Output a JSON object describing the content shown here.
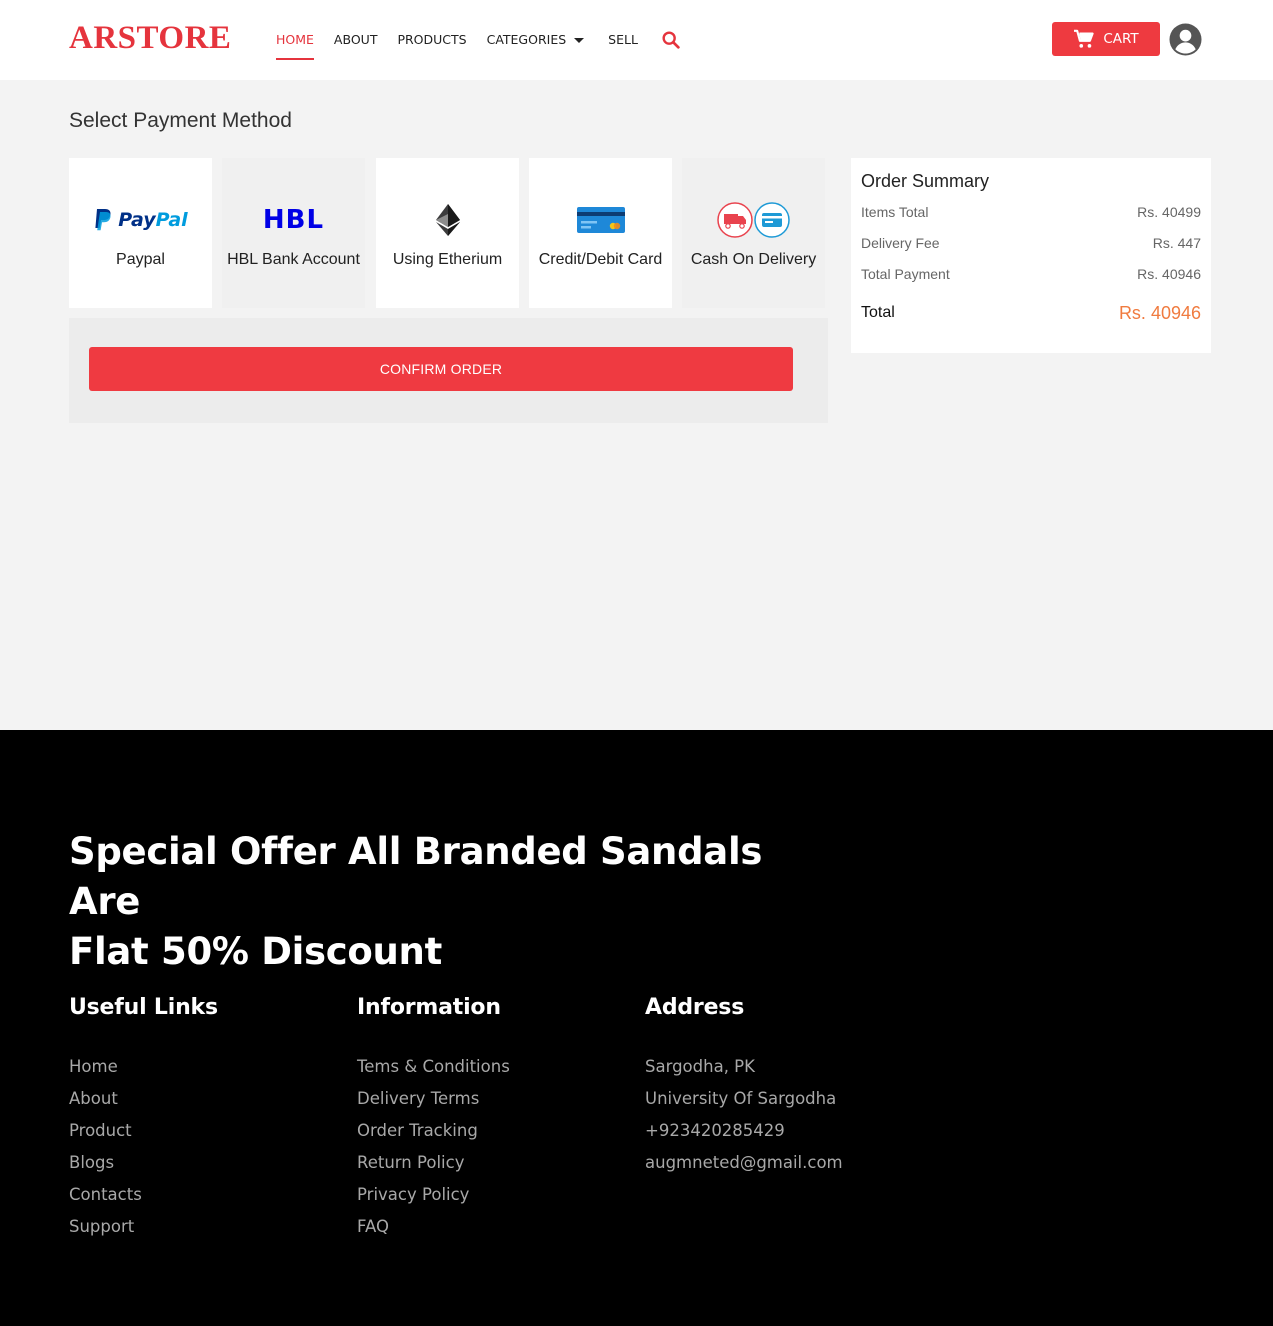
{
  "brand": {
    "logo": "ARSTORE",
    "accent": "#e5343d"
  },
  "nav": {
    "home": "HOME",
    "about": "ABOUT",
    "products": "PRODUCTS",
    "categories": "CATEGORIES",
    "sell": "SELL"
  },
  "header": {
    "cart_label": "CART"
  },
  "payment": {
    "title": "Select Payment Method",
    "methods": [
      {
        "label": "Paypal",
        "logo_text": "PayPal",
        "icon": "paypal-logo"
      },
      {
        "label": "HBL Bank Account",
        "logo_text": "HBL",
        "icon": "hbl-logo"
      },
      {
        "label": "Using Etherium",
        "icon": "ethereum-icon"
      },
      {
        "label": "Credit/Debit Card",
        "icon": "credit-card-icon"
      },
      {
        "label": "Cash On Delivery",
        "icon": "delivery-truck-icon"
      }
    ],
    "confirm_label": "CONFIRM ORDER"
  },
  "summary": {
    "title": "Order Summary",
    "rows": [
      {
        "label": "Items Total",
        "value": "Rs. 40499"
      },
      {
        "label": "Delivery Fee",
        "value": "Rs. 447"
      },
      {
        "label": "Total Payment",
        "value": "Rs. 40946"
      }
    ],
    "total_label": "Total",
    "total_value": "Rs. 40946",
    "total_color": "#f07b3f"
  },
  "footer": {
    "offer_line1": "Special Offer All Branded Sandals Are",
    "offer_line2": "Flat 50% Discount",
    "useful_links": {
      "title": "Useful Links",
      "items": [
        "Home",
        "About",
        "Product",
        "Blogs",
        "Contacts",
        "Support"
      ]
    },
    "information": {
      "title": "Information",
      "items": [
        "Tems & Conditions",
        "Delivery Terms",
        "Order Tracking",
        "Return Policy",
        "Privacy Policy",
        "FAQ"
      ]
    },
    "address": {
      "title": "Address",
      "items": [
        "Sargodha, PK",
        "University Of Sargodha",
        "+923420285429",
        "augmneted@gmail.com"
      ]
    }
  }
}
